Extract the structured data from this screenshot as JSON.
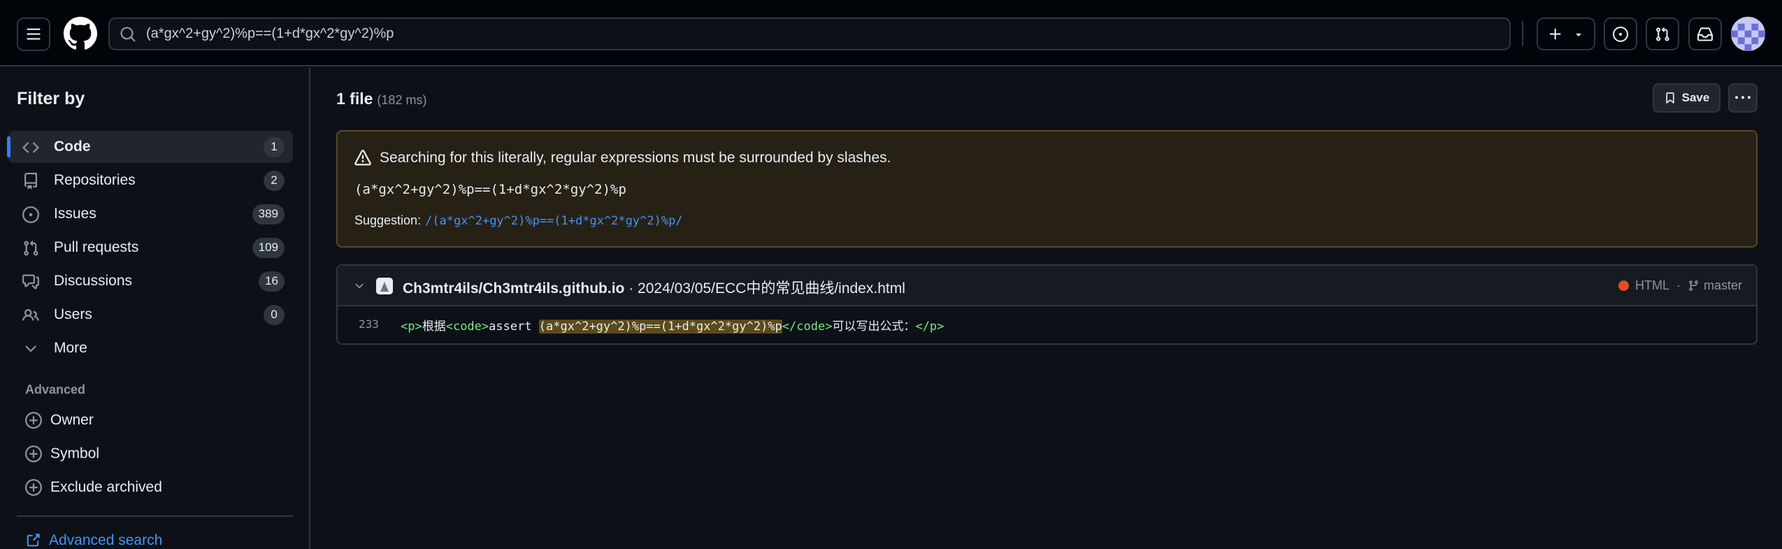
{
  "header": {
    "search_value": "(a*gx^2+gy^2)%p==(1+d*gx^2*gy^2)%p",
    "icons": [
      "hamburger-icon",
      "github-logo",
      "search-icon",
      "plus-icon",
      "chevron-down-icon",
      "issues-icon",
      "pull-request-icon",
      "inbox-icon",
      "avatar"
    ]
  },
  "sidebar": {
    "title": "Filter by",
    "items": [
      {
        "label": "Code",
        "count": "1",
        "icon": "code-icon"
      },
      {
        "label": "Repositories",
        "count": "2",
        "icon": "repo-icon"
      },
      {
        "label": "Issues",
        "count": "389",
        "icon": "issue-icon"
      },
      {
        "label": "Pull requests",
        "count": "109",
        "icon": "pull-request-icon"
      },
      {
        "label": "Discussions",
        "count": "16",
        "icon": "discussion-icon"
      },
      {
        "label": "Users",
        "count": "0",
        "icon": "people-icon"
      },
      {
        "label": "More",
        "icon": "chevron-down-icon"
      }
    ],
    "advanced_label": "Advanced",
    "advanced_items": [
      {
        "label": "Owner"
      },
      {
        "label": "Symbol"
      },
      {
        "label": "Exclude archived"
      }
    ],
    "advanced_search_label": "Advanced search"
  },
  "main": {
    "results_count": "1 file",
    "results_time": "(182 ms)",
    "save_label": "Save",
    "flash": {
      "warning": "Searching for this literally, regular expressions must be surrounded by slashes.",
      "query": "(a*gx^2+gy^2)%p==(1+d*gx^2*gy^2)%p",
      "suggestion_label": "Suggestion:",
      "suggestion_value": "/(a*gx^2+gy^2)%p==(1+d*gx^2*gy^2)%p/"
    },
    "result": {
      "repo": "Ch3mtr4ils/Ch3mtr4ils.github.io",
      "path": " · 2024/03/05/ECC中的常见曲线/index.html",
      "language": "HTML",
      "language_color": "#e34c26",
      "branch": "master",
      "line_number": "233",
      "code": {
        "open_p": "<p>",
        "text1": "根据",
        "open_code": "<code>",
        "text2": "assert ",
        "match": "(a*gx^2+gy^2)%p==(1+d*gx^2*gy^2)%p",
        "close_code": "</code>",
        "text3": "可以写出公式：",
        "close_p": "</p>"
      }
    }
  },
  "colors": {
    "accent": "#2f81f7",
    "link": "#4493f8",
    "background": "#0d1117",
    "warning_bg": "#272115"
  }
}
